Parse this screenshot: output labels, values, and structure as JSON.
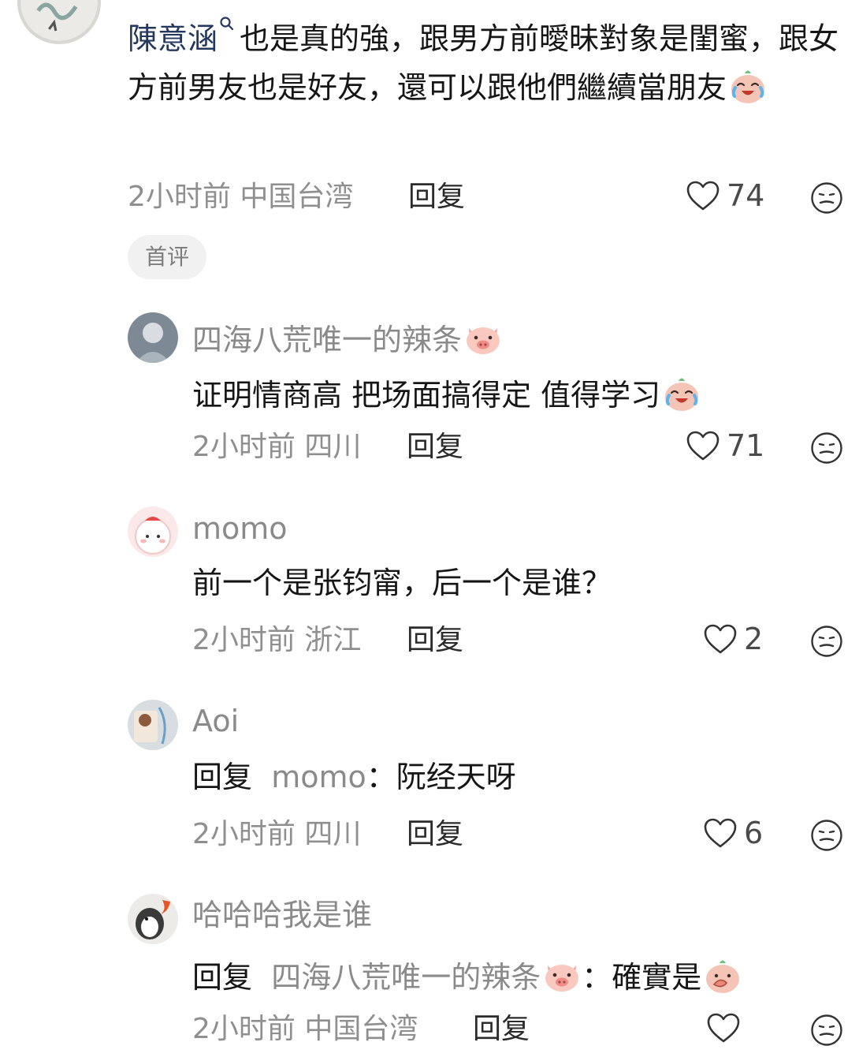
{
  "comments": [
    {
      "username": "陳意涵",
      "text": "也是真的強，跟男方前曖昧對象是閨蜜，跟女方前男友也是好友，還可以跟他們繼續當朋友",
      "time": "2小时前",
      "location": "中国台湾",
      "reply_label": "回复",
      "likes": "74",
      "badge": "首评"
    },
    {
      "username": "四海八荒唯一的辣条",
      "text": "证明情商高 把场面搞得定 值得学习",
      "time": "2小时前",
      "location": "四川",
      "reply_label": "回复",
      "likes": "71"
    },
    {
      "username": "momo",
      "text": "前一个是张钧甯，后一个是谁？",
      "time": "2小时前",
      "location": "浙江",
      "reply_label": "回复",
      "likes": "2"
    },
    {
      "username": "Aoi",
      "reply_prefix": "回复",
      "reply_target": "momo",
      "text": "：阮经天呀",
      "time": "2小时前",
      "location": "四川",
      "reply_label": "回复",
      "likes": "6"
    },
    {
      "username": "哈哈哈我是谁",
      "reply_prefix": "回复",
      "reply_target": "四海八荒唯一的辣条",
      "text": "：確實是",
      "time": "2小时前",
      "location": "中国台湾",
      "reply_label": "回复",
      "likes": ""
    }
  ],
  "icons": {
    "like": "heart-outline-icon",
    "dislike": "meh-face-icon",
    "pig": "pig-emoji",
    "crying": "crying-laugh-emoji",
    "facepalm": "facepalm-emoji"
  },
  "colors": {
    "username_primary": "#24385e",
    "username_secondary": "#8a8a8a",
    "meta": "#8f8f8f",
    "badge_bg": "#f1f1f1"
  }
}
